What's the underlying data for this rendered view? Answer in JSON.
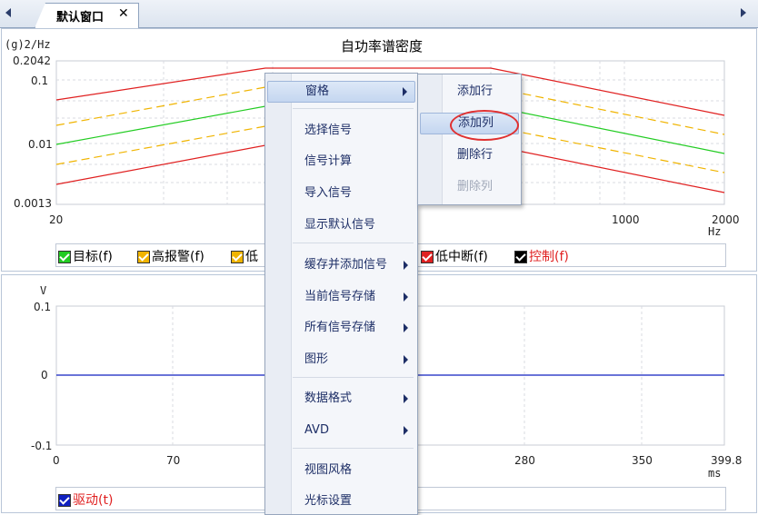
{
  "tab": {
    "title": "默认窗口",
    "close": "✕"
  },
  "psd_plot": {
    "title": "自功率谱密度",
    "y_unit": "(g)2/Hz",
    "x_unit": "Hz",
    "y_ticks": [
      "0.2042",
      "0.1",
      "0.01",
      "0.0013"
    ],
    "x_ticks": [
      "20",
      "1000",
      "2000"
    ]
  },
  "psd_legend": [
    {
      "label": "目标(f)",
      "color": "#22cc22",
      "text_color": "#000000"
    },
    {
      "label": "高报警(f)",
      "color": "#f0b400",
      "text_color": "#000000"
    },
    {
      "label": "低",
      "color": "#f0b400",
      "text_color": "#000000"
    },
    {
      "label": "低中断(f)",
      "color": "#e02020",
      "text_color": "#000000"
    },
    {
      "label": "控制(f)",
      "color": "#000000",
      "text_color": "#e02020"
    }
  ],
  "time_plot": {
    "y_unit": "V",
    "x_unit": "ms",
    "y_ticks": [
      "0.1",
      "0",
      "-0.1"
    ],
    "x_ticks": [
      "0",
      "70",
      "280",
      "350",
      "399.8"
    ]
  },
  "time_legend": [
    {
      "label": "驱动(t)",
      "color": "#1020c0",
      "text_color": "#e02020"
    }
  ],
  "context_menu": {
    "items": [
      {
        "label": "窗格",
        "submenu": true,
        "highlighted": true
      },
      {
        "label": "选择信号",
        "submenu": false
      },
      {
        "label": "信号计算",
        "submenu": false
      },
      {
        "label": "导入信号",
        "submenu": false
      },
      {
        "label": "显示默认信号",
        "submenu": false
      },
      {
        "label": "缓存并添加信号",
        "submenu": true
      },
      {
        "label": "当前信号存储",
        "submenu": true
      },
      {
        "label": "所有信号存储",
        "submenu": true
      },
      {
        "label": "图形",
        "submenu": true
      },
      {
        "label": "数据格式",
        "submenu": true
      },
      {
        "label": "AVD",
        "submenu": true
      },
      {
        "label": "视图风格",
        "submenu": false
      },
      {
        "label": "光标设置",
        "submenu": false
      }
    ]
  },
  "submenu": {
    "items": [
      {
        "label": "添加行",
        "enabled": true
      },
      {
        "label": "添加列",
        "enabled": true,
        "highlighted": true
      },
      {
        "label": "删除行",
        "enabled": true
      },
      {
        "label": "删除列",
        "enabled": false
      }
    ]
  },
  "colors": {
    "target": "#22cc22",
    "alarm": "#f0b400",
    "abort": "#e02020",
    "drive": "#1020c0",
    "menu_text": "#1d2e66",
    "focus_circle": "#e03030"
  }
}
